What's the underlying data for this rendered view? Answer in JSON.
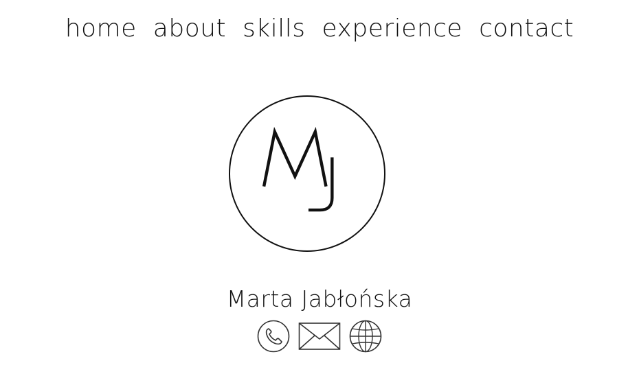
{
  "nav": {
    "items": [
      {
        "label": "home"
      },
      {
        "label": "about"
      },
      {
        "label": "skills"
      },
      {
        "label": "experience"
      },
      {
        "label": "contact"
      }
    ]
  },
  "monogram": {
    "text": "MJ"
  },
  "profile": {
    "name": "Marta Jabłońska"
  },
  "contacts": {
    "icons": [
      "phone-icon",
      "mail-icon",
      "globe-icon"
    ]
  },
  "colors": {
    "background": "#ffffff",
    "foreground": "#111111"
  }
}
